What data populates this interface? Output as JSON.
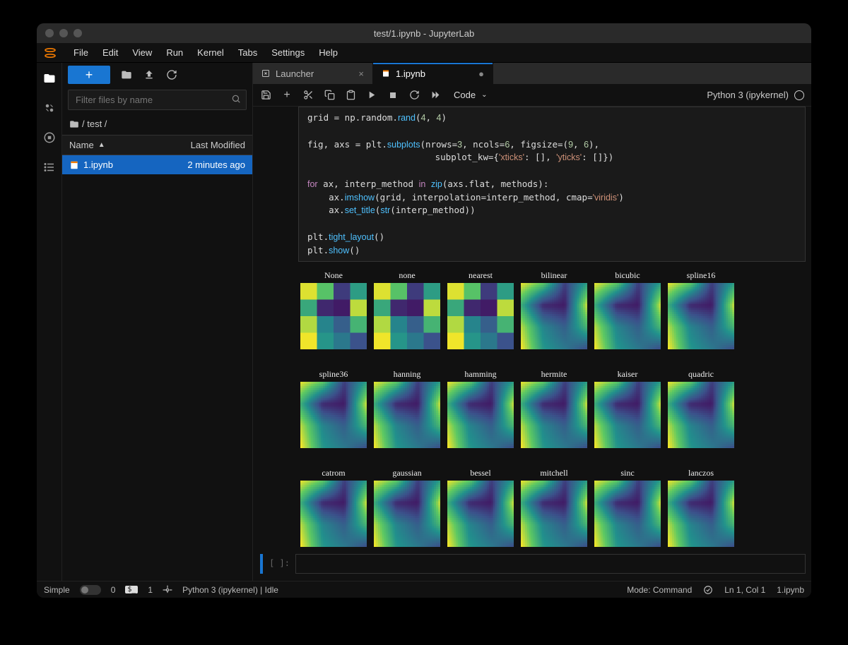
{
  "window": {
    "title": "test/1.ipynb - JupyterLab"
  },
  "menu": [
    "File",
    "Edit",
    "View",
    "Run",
    "Kernel",
    "Tabs",
    "Settings",
    "Help"
  ],
  "sidebar": {
    "filter_placeholder": "Filter files by name",
    "breadcrumb": "/ test /",
    "columns": {
      "name": "Name",
      "modified": "Last Modified"
    },
    "files": [
      {
        "name": "1.ipynb",
        "modified": "2 minutes ago",
        "selected": true
      }
    ]
  },
  "tabs": [
    {
      "label": "Launcher",
      "active": false,
      "closable": true
    },
    {
      "label": "1.ipynb",
      "active": true,
      "unsaved": true
    }
  ],
  "nbtoolbar": {
    "celltype": "Code"
  },
  "kernel": {
    "name": "Python 3 (ipykernel)"
  },
  "code_lines": [
    "grid = np.random.rand(4, 4)",
    "",
    "fig, axs = plt.subplots(nrows=3, ncols=6, figsize=(9, 6),",
    "                        subplot_kw={'xticks': [], 'yticks': []})",
    "",
    "for ax, interp_method in zip(axs.flat, methods):",
    "    ax.imshow(grid, interpolation=interp_method, cmap='viridis')",
    "    ax.set_title(str(interp_method))",
    "",
    "plt.tight_layout()",
    "plt.show()"
  ],
  "empty_prompt": "[ ]:",
  "statusbar": {
    "simple": "Simple",
    "counter0": "0",
    "counter1": "1",
    "kernel": "Python 3 (ipykernel) | Idle",
    "mode": "Mode: Command",
    "cursor": "Ln 1, Col 1",
    "file": "1.ipynb"
  },
  "chart_data": {
    "type": "heatmap",
    "nrows": 3,
    "ncols": 6,
    "cmap": "viridis",
    "grid_shape": [
      4,
      4
    ],
    "grid_values": [
      [
        0.95,
        0.72,
        0.18,
        0.55
      ],
      [
        0.6,
        0.12,
        0.08,
        0.9
      ],
      [
        0.88,
        0.45,
        0.3,
        0.65
      ],
      [
        0.98,
        0.52,
        0.4,
        0.25
      ]
    ],
    "subplot_titles": [
      "None",
      "none",
      "nearest",
      "bilinear",
      "bicubic",
      "spline16",
      "spline36",
      "hanning",
      "hamming",
      "hermite",
      "kaiser",
      "quadric",
      "catrom",
      "gaussian",
      "bessel",
      "mitchell",
      "sinc",
      "lanczos"
    ],
    "interpolation_smooth": [
      false,
      false,
      false,
      true,
      true,
      true,
      true,
      true,
      true,
      true,
      true,
      true,
      true,
      true,
      true,
      true,
      true,
      true
    ]
  }
}
